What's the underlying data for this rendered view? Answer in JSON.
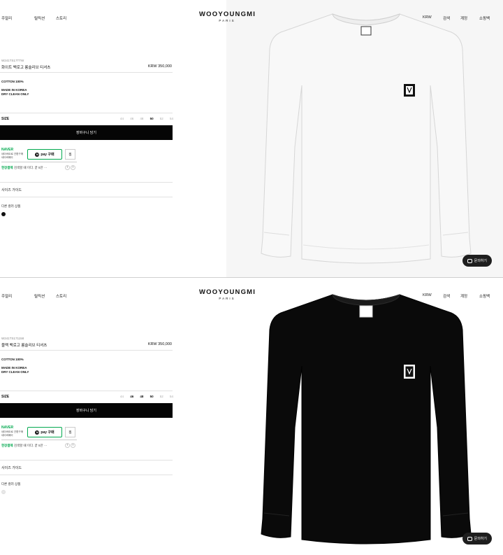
{
  "nav": {
    "left": [
      "주얼리",
      "릴릭션",
      "스토리"
    ],
    "right": [
      "KRW",
      "검색",
      "계정",
      "쇼핑백"
    ]
  },
  "logo": {
    "main": "WOOYOUNGMI",
    "sub": "PARIS"
  },
  "products": [
    {
      "sku": "W241TS17TTW",
      "name": "화이트 백로고 롱슬리브 티셔츠",
      "price": "KRW 350,000",
      "composition": "COTTON 100%",
      "made_in": "MADE IN KOREA",
      "care": "DRY CLEAN ONLY",
      "size_label": "SIZE",
      "sizes": [
        "44",
        "46",
        "48",
        "50",
        "52",
        "54"
      ],
      "selected_size": "50",
      "cart_label": "장바구니 담기",
      "naver_logo": "NAVER",
      "naver_line1": "네이버ID로 간편구매",
      "naver_line2": "네이버페이",
      "npay_label": "pay 구매",
      "jjim_label": "찜",
      "promo_green": "현장결제",
      "promo_text": "검색할 때 이다. 끝 5만 ···",
      "size_guide": "사이즈 가이드",
      "other_colors": "다른 컬러 상품",
      "swatch_color": "#111111",
      "shirt_color": "#f8f8f8",
      "inquiry_label": "문의하기"
    },
    {
      "sku": "W241TS171158",
      "name": "블랙 백로고 롱슬리브 티셔츠",
      "price": "KRW 350,000",
      "composition": "COTTON 100%",
      "made_in": "MADE IN KOREA",
      "care": "DRY CLEAN ONLY",
      "size_label": "SIZE",
      "sizes": [
        "44",
        "46",
        "48",
        "50",
        "52",
        "54"
      ],
      "selected_size": "48",
      "cart_label": "장바구니 담기",
      "naver_logo": "NAVER",
      "naver_line1": "네이버ID로 간편구매",
      "naver_line2": "네이버페이",
      "npay_label": "pay 구매",
      "jjim_label": "찜",
      "promo_green": "현장결제",
      "promo_text": "검색할 때 이다. 끝 5만 ···",
      "size_guide": "사이즈 가이드",
      "other_colors": "다른 컬러 상품",
      "swatch_color": "#e8e8e8",
      "shirt_color": "#0a0a0a",
      "inquiry_label": "문의하기"
    }
  ]
}
